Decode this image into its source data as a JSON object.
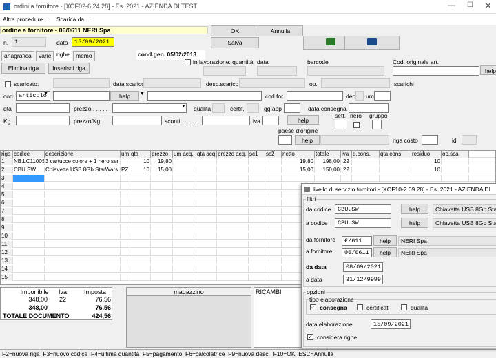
{
  "window": {
    "title": "ordini a fornitore - [XOF02-6.24.28] - Es. 2021 - AZIENDA DI TEST"
  },
  "menu": {
    "items": [
      "Altre procedure...",
      "Scarica da..."
    ]
  },
  "header": {
    "doc_title": "ordine a fornitore - 06/0611 NERI Spa",
    "n_label": "n.",
    "n_value": "1",
    "data_label": "data",
    "data_value": "15/09/2021",
    "cond_gen": "cond.gen. 05/02/2013"
  },
  "actions": {
    "ok": "OK",
    "annulla": "Annulla",
    "salva": "Salva"
  },
  "tabs": [
    "anagrafica",
    "varie",
    "righe",
    "memo"
  ],
  "row_buttons": {
    "elimina": "Elimina riga",
    "inserisci": "Inserisci riga"
  },
  "fields": {
    "in_lavorazione": "in lavorazione: quantità",
    "data": "data",
    "barcode": "barcode",
    "cod_originale": "Cod. originale art.",
    "help": "help",
    "scaricato": "scaricato:",
    "data_scarico": "data scarico",
    "desc_scarico": "desc.scarico",
    "op": "op.",
    "scarichi": "scarichi",
    "cod": "cod.",
    "cod_type": "articolo",
    "cod_for": "cod.for.",
    "dec": "dec",
    "um": "um",
    "qta": "qta",
    "prezzo": "prezzo . . . . . .",
    "qualita": "qualità",
    "certif": "certif.",
    "gg_app": "gg.app",
    "data_consegna": "data consegna",
    "kg": "Kg",
    "prezzo_kg": "prezzo/Kg",
    "sconti": "sconti . . . . .",
    "iva": "iva",
    "sett": "sett.",
    "nero": "nero",
    "gruppo": "gruppo",
    "paese": "paese d'origine",
    "riga_costo": "riga costo",
    "id": "id"
  },
  "grid": {
    "columns": [
      "riga",
      "codice",
      "descrizione",
      "um",
      "qta",
      "prezzo",
      "um acq.",
      "qtà acq.",
      "prezzo acq.",
      "sc1",
      "sc2",
      "netto",
      "totale",
      "iva",
      "d.cons.",
      "qta cons.",
      "residuo",
      "op.sca"
    ],
    "rows": [
      [
        "1",
        "NB.LC1100S",
        "3 cartucce colore + 1 nero ser",
        "",
        "10",
        "19,80",
        "",
        "",
        "",
        "",
        "",
        "19,80",
        "198,00",
        "22",
        "",
        "",
        "10",
        ""
      ],
      [
        "2",
        "CBU.SW",
        "Chiavetta USB 8Gb StarWars",
        "PZ",
        "10",
        "15,00",
        "",
        "",
        "",
        "",
        "",
        "15,00",
        "150,00",
        "22",
        "",
        "",
        "10",
        ""
      ],
      [
        "3",
        "",
        "",
        "",
        "",
        "",
        "",
        "",
        "",
        "",
        "",
        "",
        "",
        "",
        "",
        "",
        "",
        ""
      ],
      [
        "4"
      ],
      [
        "5"
      ],
      [
        "6"
      ],
      [
        "7"
      ],
      [
        "8"
      ],
      [
        "9"
      ],
      [
        "10"
      ],
      [
        "11"
      ],
      [
        "12"
      ],
      [
        "13"
      ],
      [
        "14"
      ],
      [
        "15"
      ]
    ]
  },
  "totals": {
    "headers": [
      "Imponibile",
      "Iva",
      "Imposta"
    ],
    "row": [
      "348,00",
      "22",
      "76,56"
    ],
    "subtotal": [
      "348,00",
      "76,56"
    ],
    "total_label": "TOTALE DOCUMENTO",
    "total_value": "424,56",
    "magazzino": "magazzino",
    "ricambi": "RICAMBI"
  },
  "statusbar": "F2=nuova riga  F3=nuovo codice  F4=ultima quantità  F5=pagamento  F6=calcolatrice  F9=nuova desc.  F10=OK  ESC=Annulla",
  "dialog": {
    "title": "livello di servizio fornitori - [XOF10-2.09.28] - Es. 2021 - AZIENDA DI",
    "filtri": "filtri",
    "da_codice": "da codice",
    "da_codice_val": "CBU.SW",
    "a_codice": "a codice",
    "a_codice_val": "CBU.SW",
    "desc1": "Chiavetta USB 8Gb StarWars",
    "desc2": "Chiavetta USB 8Gb StarWars",
    "help": "help",
    "da_fornitore": "da fornitore",
    "da_fornitore_val": "€/611",
    "a_fornitore": "a fornitore",
    "a_fornitore_val": "06/0611",
    "forn1": "NERI Spa",
    "forn2": "NERI Spa",
    "da_data": "da data",
    "da_data_val": "08/09/2021",
    "a_data": "a data",
    "a_data_val": "31/12/9999",
    "opzioni": "opzioni",
    "tipo": "tipo elaborazione",
    "consegna": "consegna",
    "certificati": "certificati",
    "qualita": "qualità",
    "data_elab": "data elaborazione",
    "data_elab_val": "15/09/2021",
    "considera": "considera righe"
  },
  "colors": {
    "yellow": "#ffff00",
    "selection": "#cce8ff",
    "cell_focus": "#3399ff"
  }
}
